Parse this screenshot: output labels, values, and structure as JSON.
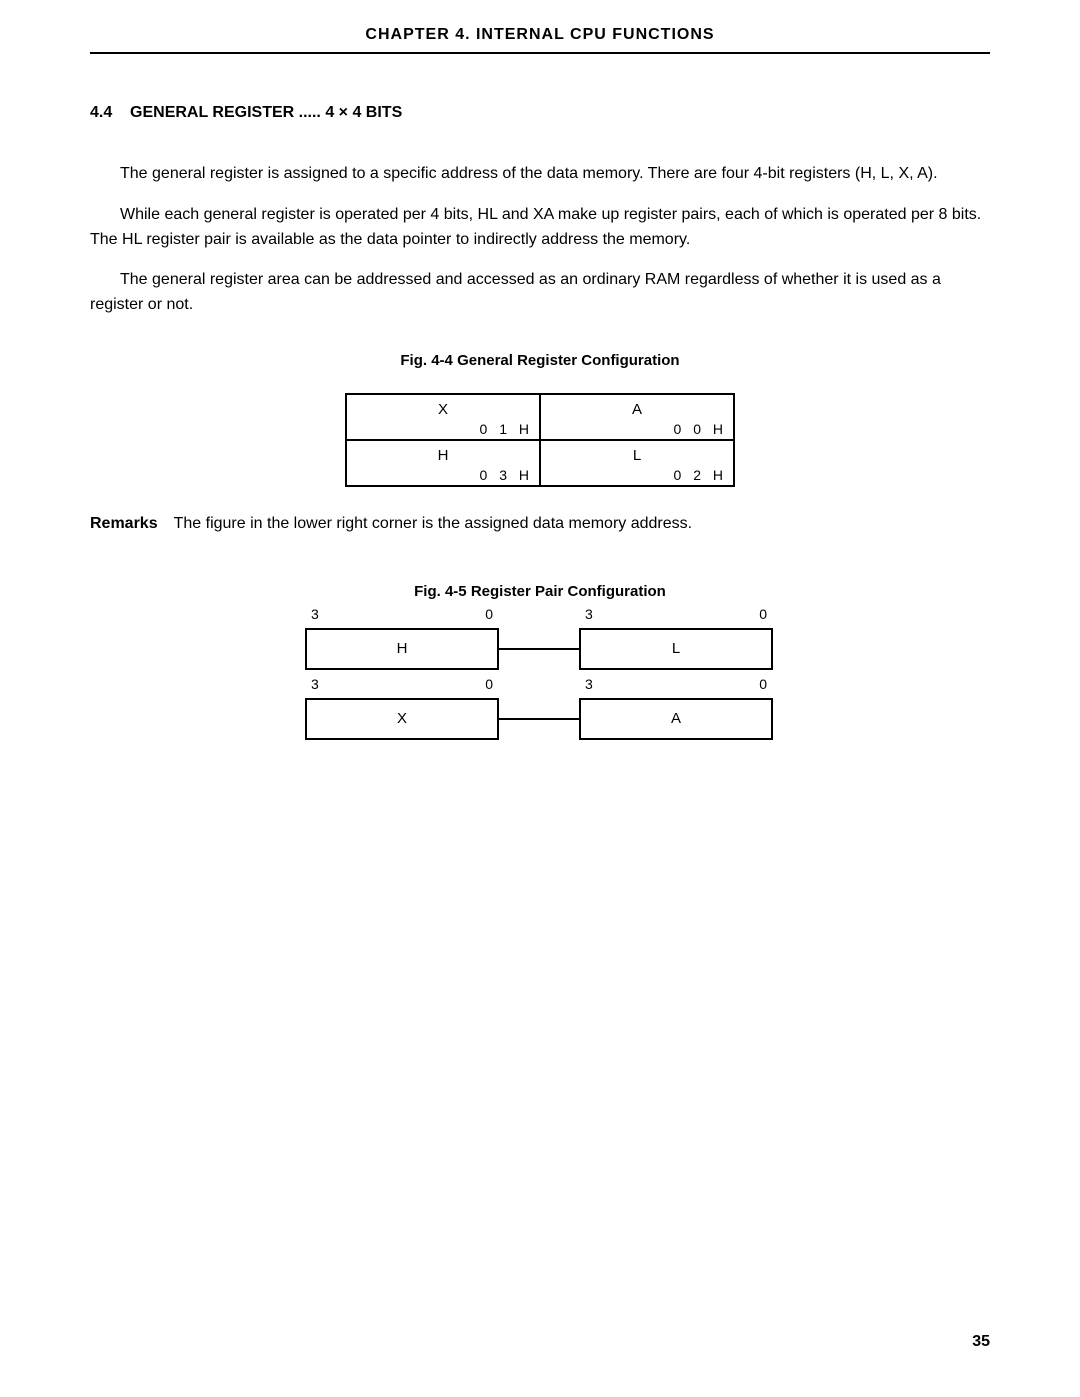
{
  "header": {
    "chapter": "CHAPTER  4.   INTERNAL  CPU  FUNCTIONS"
  },
  "section": {
    "number": "4.4",
    "title": "GENERAL REGISTER ..... 4 × 4 BITS"
  },
  "paragraphs": {
    "p1": "The general register is assigned to a specific address of the data memory. There are four 4-bit registers (H, L, X, A).",
    "p2": "While each general register is operated per 4 bits, HL and XA make up register pairs, each of which is operated per 8 bits. The HL register pair is available as the data pointer to indirectly address the memory.",
    "p3": "The general register area can be addressed and accessed as an ordinary RAM regardless of whether it is used as a register or not."
  },
  "fig44": {
    "caption": "Fig. 4-4 General Register Configuration",
    "cells": [
      {
        "name": "X",
        "addr": "0 1 H"
      },
      {
        "name": "A",
        "addr": "0 0 H"
      },
      {
        "name": "H",
        "addr": "0 3 H"
      },
      {
        "name": "L",
        "addr": "0 2 H"
      }
    ]
  },
  "remarks": {
    "label": "Remarks",
    "text": "The figure in the lower right corner is the assigned data memory address."
  },
  "fig45": {
    "caption": "Fig. 4-5 Register Pair Configuration",
    "pairs": [
      {
        "left": "H",
        "right": "L",
        "bit_hi": "3",
        "bit_lo": "0"
      },
      {
        "left": "X",
        "right": "A",
        "bit_hi": "3",
        "bit_lo": "0"
      }
    ]
  },
  "page_number": "35"
}
